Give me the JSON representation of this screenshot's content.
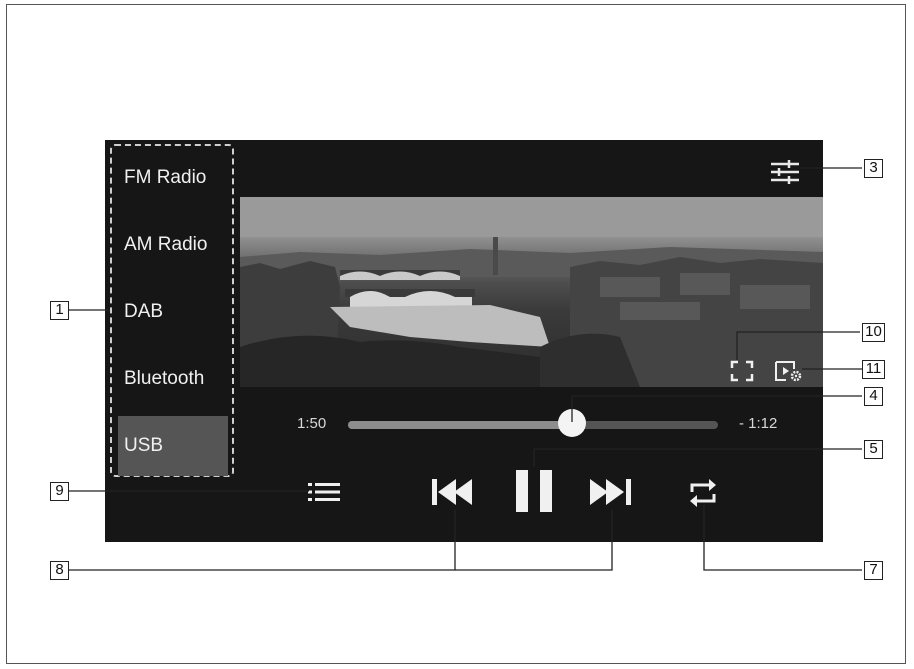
{
  "sources": [
    {
      "label": "FM Radio",
      "active": false
    },
    {
      "label": "AM Radio",
      "active": false
    },
    {
      "label": "DAB",
      "active": false
    },
    {
      "label": "Bluetooth",
      "active": false
    },
    {
      "label": "USB",
      "active": true
    }
  ],
  "player": {
    "elapsed": "1:50",
    "remaining": "- 1:12",
    "progress_fraction": 0.605
  },
  "icons": {
    "settings": "sliders-icon",
    "fullscreen": "fullscreen-icon",
    "video_settings": "video-settings-icon",
    "playlist": "playlist-icon",
    "previous": "skip-previous-icon",
    "play_pause": "pause-icon",
    "next": "skip-next-icon",
    "repeat": "repeat-icon"
  },
  "callouts": {
    "c1": "1",
    "c3": "3",
    "c4": "4",
    "c5": "5",
    "c7": "7",
    "c8": "8",
    "c9": "9",
    "c10": "10",
    "c11": "11"
  },
  "colors": {
    "screen_bg": "#161616",
    "active_source": "#555555",
    "text": "#f0f0f0"
  }
}
